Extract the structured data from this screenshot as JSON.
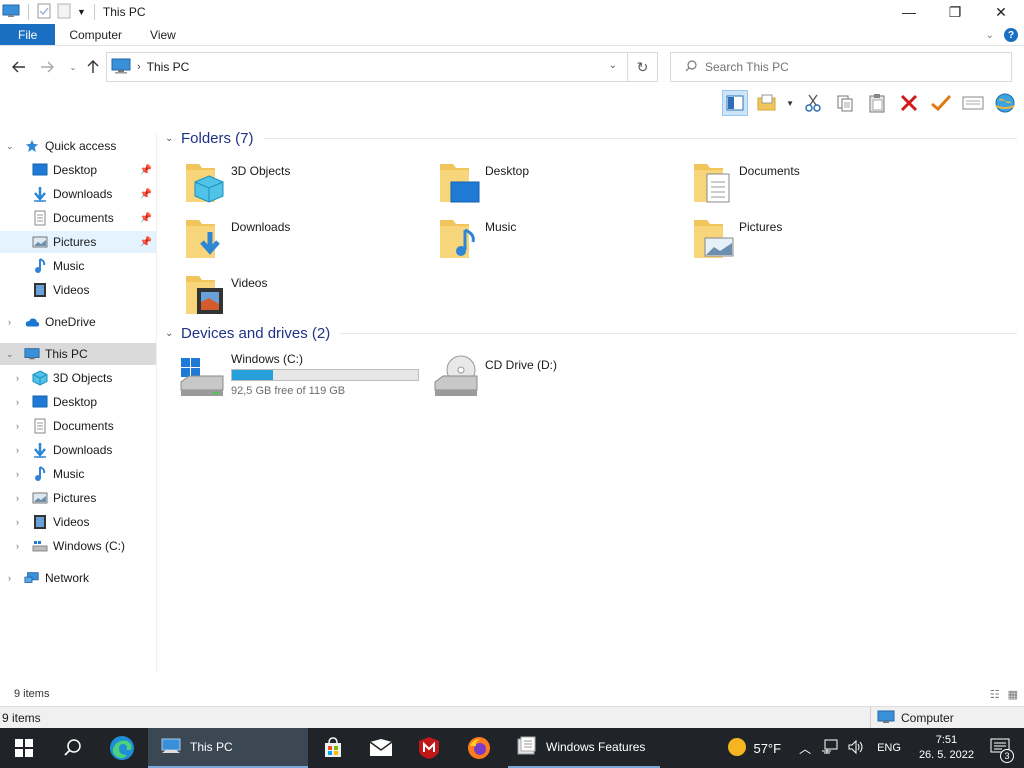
{
  "window": {
    "title": "This PC",
    "minimize": "—",
    "maximize": "❐",
    "close": "✕"
  },
  "ribbon": {
    "tabs": [
      "File",
      "Computer",
      "View"
    ]
  },
  "address": {
    "location": "This PC",
    "search_placeholder": "Search This PC"
  },
  "sidebar": {
    "quick_access": "Quick access",
    "quick_items": [
      "Desktop",
      "Downloads",
      "Documents",
      "Pictures",
      "Music",
      "Videos"
    ],
    "onedrive": "OneDrive",
    "this_pc": "This PC",
    "pc_items": [
      "3D Objects",
      "Desktop",
      "Documents",
      "Downloads",
      "Music",
      "Pictures",
      "Videos",
      "Windows (C:)"
    ],
    "network": "Network"
  },
  "content": {
    "folders_header": "Folders (7)",
    "folders": [
      "3D Objects",
      "Desktop",
      "Documents",
      "Downloads",
      "Music",
      "Pictures",
      "Videos"
    ],
    "devices_header": "Devices and drives (2)",
    "drives": [
      {
        "name": "Windows (C:)",
        "free": "92,5 GB free of 119 GB",
        "used_fraction": 0.22
      },
      {
        "name": "CD Drive (D:)"
      }
    ]
  },
  "status": {
    "items": "9 items",
    "items2": "9 items",
    "zone": "Computer"
  },
  "taskbar": {
    "explorer_label": "This PC",
    "features_label": "Windows Features",
    "temperature": "57°F",
    "language": "ENG",
    "time": "7:51",
    "date": "26. 5. 2022",
    "notifications": "3"
  },
  "colors": {
    "accent": "#1a6fc3",
    "folder": "#f2c55c",
    "group_header": "#1e3287",
    "taskbar": "#202428"
  }
}
